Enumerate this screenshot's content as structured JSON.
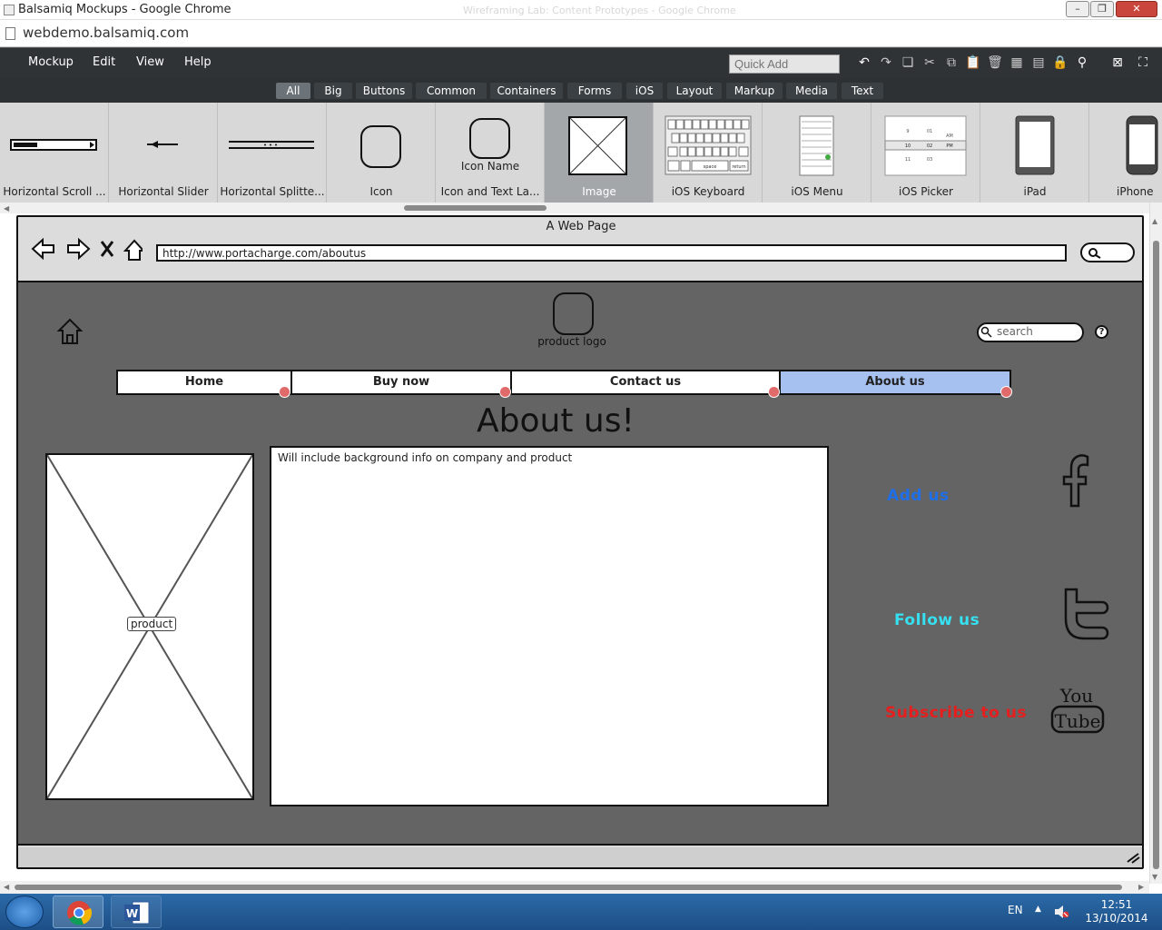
{
  "window": {
    "title": "Balsamiq Mockups - Google Chrome",
    "ghost_title": "Wireframing Lab: Content Prototypes - Google Chrome",
    "url": "webdemo.balsamiq.com"
  },
  "menubar": {
    "items": [
      "Mockup",
      "Edit",
      "View",
      "Help"
    ],
    "quick_add_placeholder": "Quick Add"
  },
  "filter_tabs": {
    "items": [
      "All",
      "Big",
      "Buttons",
      "Common",
      "Containers",
      "Forms",
      "iOS",
      "Layout",
      "Markup",
      "Media",
      "Text"
    ],
    "selected": "All"
  },
  "library": {
    "items": [
      {
        "label": "Horizontal Scroll ..."
      },
      {
        "label": "Horizontal Slider"
      },
      {
        "label": "Horizontal Splitte..."
      },
      {
        "label": "Icon"
      },
      {
        "label": "Icon and Text La...",
        "icon_text": "Icon Name"
      },
      {
        "label": "Image"
      },
      {
        "label": "iOS Keyboard",
        "key_space": "space",
        "key_return": "return"
      },
      {
        "label": "iOS Menu"
      },
      {
        "label": "iOS Picker",
        "hours": [
          "9",
          "10",
          "11"
        ],
        "minutes": [
          "01",
          "02",
          "03"
        ],
        "ampm": [
          "AM",
          "PM"
        ]
      },
      {
        "label": "iPad"
      },
      {
        "label": "iPhone"
      }
    ],
    "selected": "Image"
  },
  "mockup": {
    "page_title": "A Web Page",
    "address": "http://www.portacharge.com/aboutus",
    "logo_label": "product logo",
    "search_placeholder": "search",
    "help_label": "?",
    "nav": [
      {
        "label": "Home"
      },
      {
        "label": "Buy now"
      },
      {
        "label": "Contact us"
      },
      {
        "label": "About us"
      }
    ],
    "nav_selected": "About us",
    "heading": "About us!",
    "product_label": "product",
    "body_text": "Will include background info on company and product",
    "social": [
      {
        "label": "Add us",
        "color": "#1f6fe8",
        "icon": "facebook-icon"
      },
      {
        "label": "Follow us",
        "color": "#35e0f0",
        "icon": "twitter-icon"
      },
      {
        "label": "Subscribe to us",
        "color": "#e61e1e",
        "icon": "youtube-icon"
      }
    ],
    "youtube_icon_text": [
      "You",
      "Tube"
    ]
  },
  "taskbar": {
    "language": "EN",
    "time": "12:51",
    "date": "13/10/2014"
  }
}
